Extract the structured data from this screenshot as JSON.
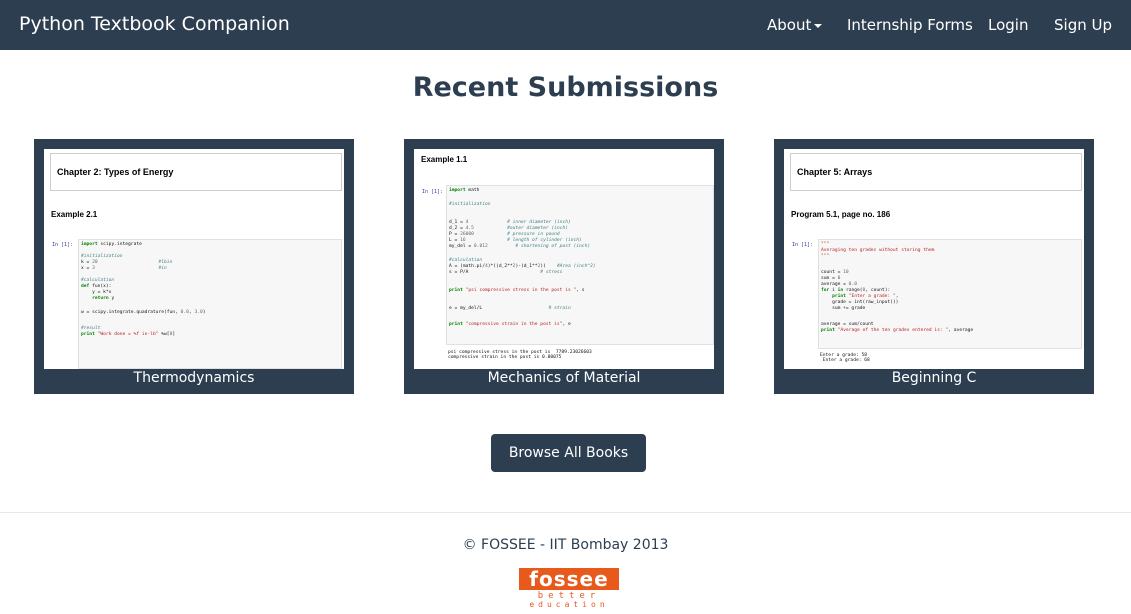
{
  "navbar": {
    "brand": "Python Textbook Companion",
    "links": {
      "about": "About",
      "forms": "Internship Forms",
      "login": "Login",
      "signup": "Sign Up"
    }
  },
  "main": {
    "title": "Recent Submissions",
    "cards": [
      {
        "caption": "Thermodynamics",
        "heading": "Chapter 2: Types of Energy",
        "sub": "Example 2.1",
        "prompt": "In [1]:"
      },
      {
        "caption": "Mechanics of Material",
        "heading": "Example 1.1",
        "prompt": "In [1]:"
      },
      {
        "caption": "Beginning C",
        "heading": "Chapter 5: Arrays",
        "sub": "Program 5.1, page no. 186",
        "prompt": "In [1]:"
      }
    ],
    "browse_button": "Browse All Books"
  },
  "footer": {
    "copyright": "© FOSSEE - IIT Bombay 2013",
    "logo": {
      "word": "fossee",
      "tag1": "better",
      "tag2": "education",
      "color": "#e8591c"
    }
  },
  "colors": {
    "primary": "#2c3e50",
    "white": "#ffffff"
  }
}
